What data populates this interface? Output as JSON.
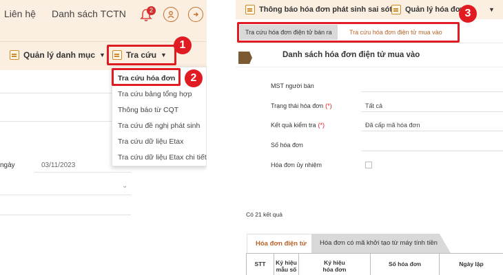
{
  "left": {
    "nav": {
      "contact": "Liên hệ",
      "tctn_list": "Danh sách TCTN",
      "notification_count": "2"
    },
    "menu": {
      "category_mgmt": "Quản lý danh mục",
      "lookup": "Tra cứu"
    },
    "dropdown": [
      "Tra cứu hóa đơn",
      "Tra cứu bảng tổng hợp",
      "Thông báo từ CQT",
      "Tra cứu đề nghị phát sinh",
      "Tra cứu dữ liệu Etax",
      "Tra cứu dữ liệu Etax chi tiết"
    ],
    "form": {
      "date_label": "ngày",
      "date_value": "03/11/2023"
    }
  },
  "right": {
    "menu": {
      "error_notice": "Thông báo hóa đơn phát sinh sai sót",
      "invoice_mgmt": "Quản lý hóa đơn p"
    },
    "tabs": {
      "sold": "Tra cứu hóa đơn điện tử bán ra",
      "purchased": "Tra cứu hóa đơn điện tử mua vào"
    },
    "section_title": "Danh sách hóa đơn điện tử mua vào",
    "form": {
      "seller_tax_label": "MST người bán",
      "status_label": "Trạng thái hóa đơn",
      "status_value": "Tất cả",
      "check_result_label": "Kết quả kiểm tra",
      "check_result_value": "Đã cấp mã hóa đơn",
      "invoice_no_label": "Số hóa đơn",
      "authorized_label": "Hóa đơn ủy nhiệm",
      "required_mark": "(*)"
    },
    "result_count": "Có 21 kết quả",
    "result_tabs": {
      "einvoice": "Hóa đơn điện tử",
      "cash_register": "Hóa đơn có mã khởi tạo từ máy tính tiền"
    },
    "table_headers": {
      "stt": "STT",
      "template_symbol_1": "Ký hiệu",
      "template_symbol_2": "mẫu số",
      "invoice_symbol_1": "Ký hiệu",
      "invoice_symbol_2": "hóa đơn",
      "invoice_no": "Số hóa đơn",
      "created_date": "Ngày lập"
    }
  },
  "callouts": {
    "one": "1",
    "two": "2",
    "three": "3"
  },
  "colors": {
    "accent": "#b8642a",
    "header_bg": "#fbefe2",
    "highlight": "#e11b22"
  }
}
